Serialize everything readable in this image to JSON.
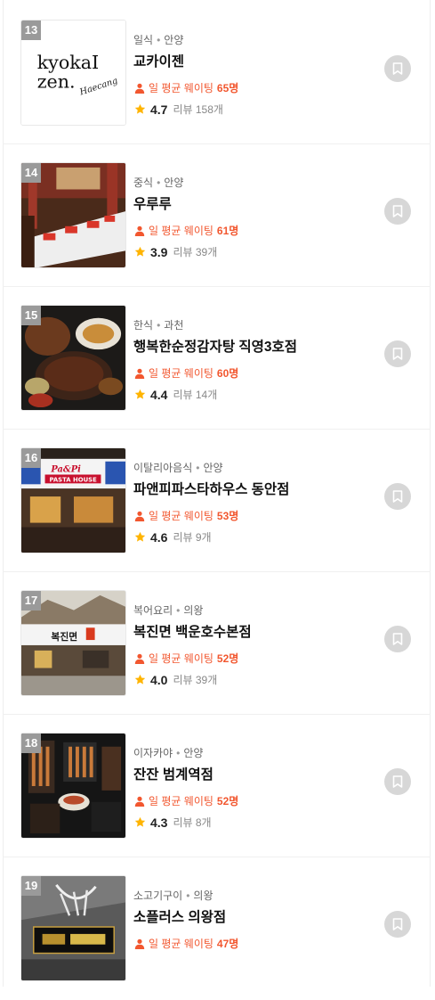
{
  "restaurants": [
    {
      "rank": "13",
      "category": "일식",
      "region": "안양",
      "name": "교카이젠",
      "wait_label": "일 평균 웨이팅",
      "wait_count": "65명",
      "rating": "4.7",
      "reviews": "리뷰 158개",
      "logo_line1": "kyokaI",
      "logo_line2": "zen.",
      "logo_script": "Haecang"
    },
    {
      "rank": "14",
      "category": "중식",
      "region": "안양",
      "name": "우루루",
      "wait_label": "일 평균 웨이팅",
      "wait_count": "61명",
      "rating": "3.9",
      "reviews": "리뷰 39개"
    },
    {
      "rank": "15",
      "category": "한식",
      "region": "과천",
      "name": "행복한순정감자탕 직영3호점",
      "wait_label": "일 평균 웨이팅",
      "wait_count": "60명",
      "rating": "4.4",
      "reviews": "리뷰 14개"
    },
    {
      "rank": "16",
      "category": "이탈리아음식",
      "region": "안양",
      "name": "파앤피파스타하우스 동안점",
      "wait_label": "일 평균 웨이팅",
      "wait_count": "53명",
      "rating": "4.6",
      "reviews": "리뷰 9개",
      "sign_line1": "Pa&Pi",
      "sign_line2": "PASTA HOUSE"
    },
    {
      "rank": "17",
      "category": "복어요리",
      "region": "의왕",
      "name": "복진면 백운호수본점",
      "wait_label": "일 평균 웨이팅",
      "wait_count": "52명",
      "rating": "4.0",
      "reviews": "리뷰 39개",
      "sign_text": "복진면"
    },
    {
      "rank": "18",
      "category": "이자카야",
      "region": "안양",
      "name": "잔잔 범계역점",
      "wait_label": "일 평균 웨이팅",
      "wait_count": "52명",
      "rating": "4.3",
      "reviews": "리뷰 8개"
    },
    {
      "rank": "19",
      "category": "소고기구이",
      "region": "의왕",
      "name": "소플러스 의왕점",
      "wait_label": "일 평균 웨이팅",
      "wait_count": "47명"
    }
  ],
  "colors": {
    "accent": "#f2572f",
    "star": "#ffb400",
    "rank_badge": "#9a9a9a",
    "save_button": "#d7d7d7"
  },
  "icons": {
    "wait": "person-icon",
    "rating": "star-icon",
    "save": "bookmark-icon"
  }
}
